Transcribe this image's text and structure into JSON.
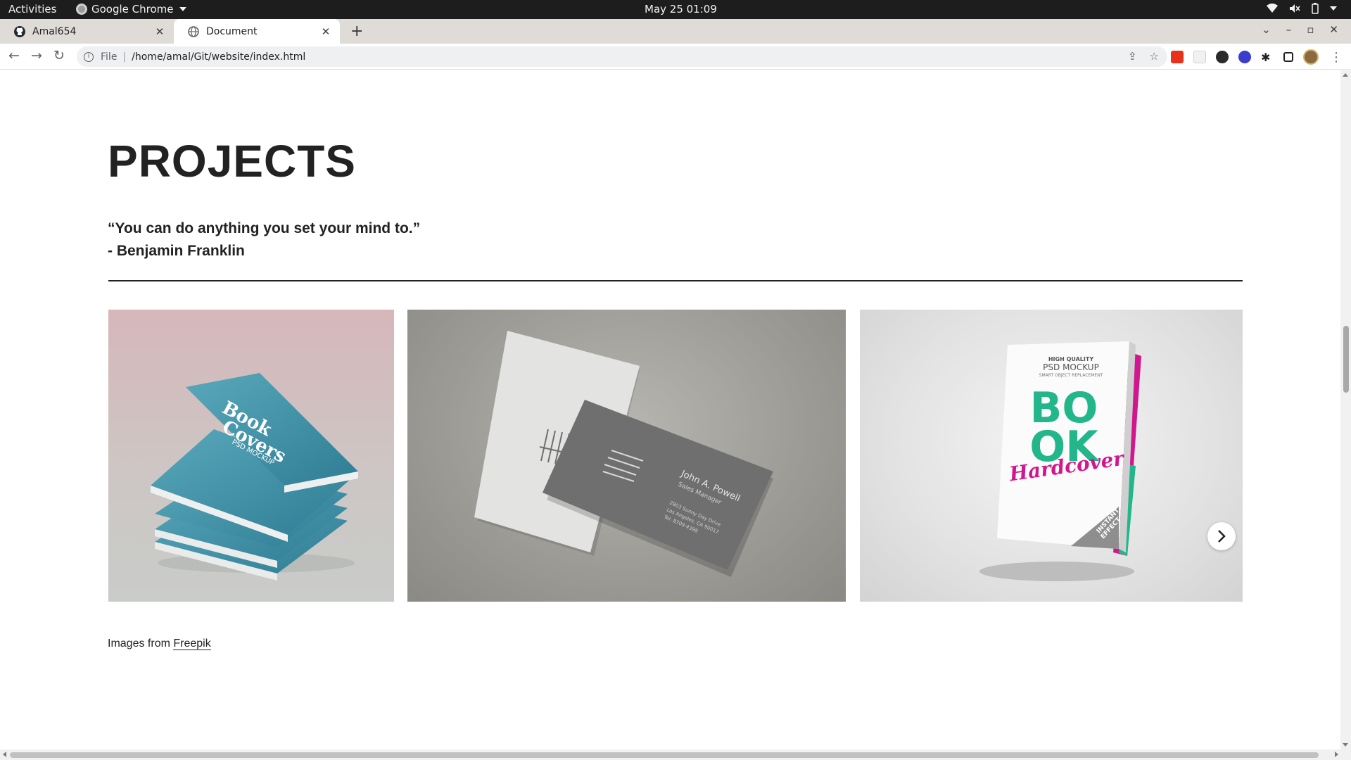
{
  "system_bar": {
    "activities": "Activities",
    "app_name": "Google Chrome",
    "datetime": "May 25  01:09"
  },
  "tabs": [
    {
      "label": "Amal654",
      "icon": "github-icon",
      "active": false
    },
    {
      "label": "Document",
      "icon": "globe-icon",
      "active": true
    }
  ],
  "omnibox": {
    "scheme_label": "File",
    "url": "/home/amal/Git/website/index.html"
  },
  "page": {
    "heading": "PROJECTS",
    "quote_line1": "“You can do anything you set your mind to.”",
    "quote_line2": "- Benjamin Franklin",
    "gallery": {
      "images": [
        {
          "texts": [
            "Book",
            "Covers",
            "PSD MOCKUP"
          ]
        },
        {
          "texts": [
            "John A. Powell",
            "Sales Manager",
            "2803 Sunny Day Drive",
            "Los Angeles, CA 90017",
            "Tel: 8709-4398"
          ]
        },
        {
          "texts": [
            "HIGH QUALITY",
            "PSD MOCKUP",
            "SMART OBJECT REPLACEMENT",
            "BO",
            "OK",
            "Hardcover",
            "INSTANT",
            "EFFECT"
          ]
        }
      ]
    },
    "credit_prefix": "Images from",
    "credit_link": "Freepik"
  },
  "colors": {
    "accent_green": "#23b68a",
    "accent_pink": "#d0178e",
    "book_teal": "#3f8fa6"
  }
}
